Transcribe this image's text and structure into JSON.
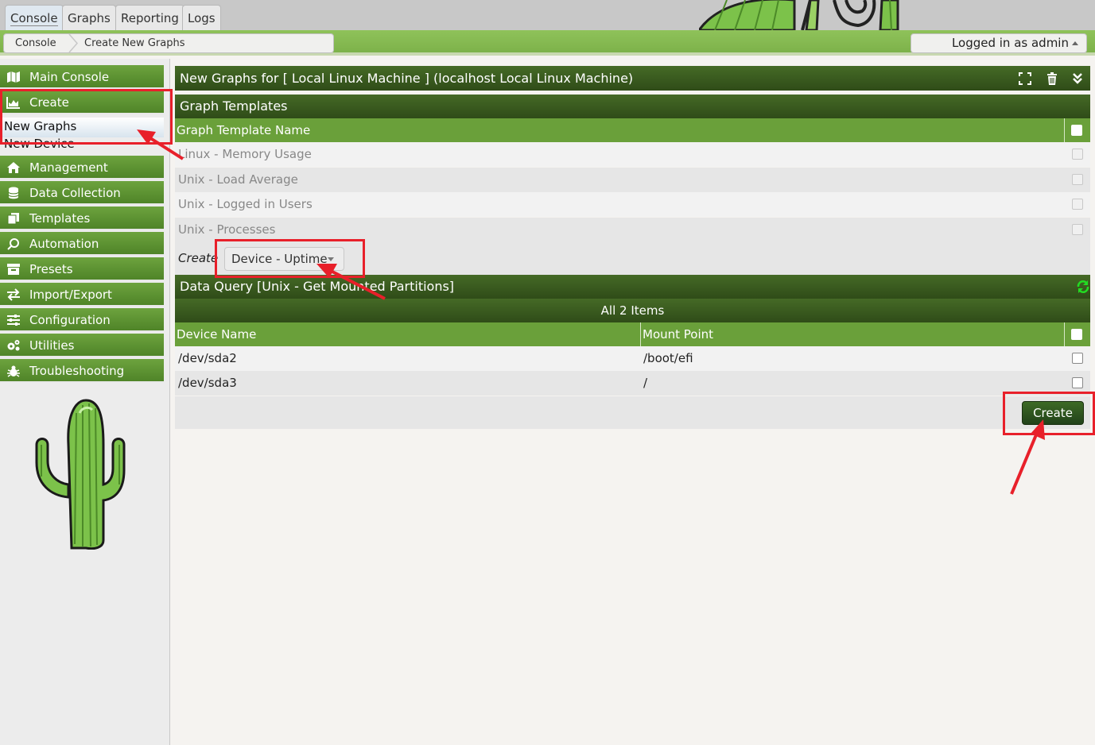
{
  "top_tabs": [
    "Console",
    "Graphs",
    "Reporting",
    "Logs"
  ],
  "breadcrumb": {
    "root": "Console",
    "current": "Create New Graphs"
  },
  "login": {
    "text": "Logged in as admin"
  },
  "sidebar": {
    "items": [
      {
        "label": "Main Console",
        "icon": "map-icon"
      },
      {
        "label": "Create",
        "icon": "chart-icon"
      },
      {
        "label": "Management",
        "icon": "home-icon"
      },
      {
        "label": "Data Collection",
        "icon": "database-icon"
      },
      {
        "label": "Templates",
        "icon": "copy-icon"
      },
      {
        "label": "Automation",
        "icon": "automation-icon"
      },
      {
        "label": "Presets",
        "icon": "archive-icon"
      },
      {
        "label": "Import/Export",
        "icon": "exchange-icon"
      },
      {
        "label": "Configuration",
        "icon": "sliders-icon"
      },
      {
        "label": "Utilities",
        "icon": "cogs-icon"
      },
      {
        "label": "Troubleshooting",
        "icon": "bug-icon"
      }
    ],
    "sub_items": {
      "new_graphs": "New Graphs",
      "new_device": "New Device"
    }
  },
  "panel": {
    "title": "New Graphs for [ Local Linux Machine ] (localhost Local Linux Machine)"
  },
  "graph_templates": {
    "header": "Graph Templates",
    "column": "Graph Template Name",
    "rows": [
      "Linux - Memory Usage",
      "Unix - Load Average",
      "Unix - Logged in Users",
      "Unix - Processes"
    ],
    "create_label": "Create",
    "selected_template": "Device - Uptime"
  },
  "data_query": {
    "header": "Data Query [Unix - Get Mounted Partitions]",
    "items_count": "All 2 Items",
    "columns": [
      "Device Name",
      "Mount Point"
    ],
    "rows": [
      {
        "device": "/dev/sda2",
        "mount": "/boot/efi"
      },
      {
        "device": "/dev/sda3",
        "mount": "/"
      }
    ]
  },
  "actions": {
    "create_button": "Create"
  },
  "colors": {
    "accent_green": "#6aa03a",
    "dark_green": "#2f4c18",
    "annotation_red": "#e8202a"
  }
}
